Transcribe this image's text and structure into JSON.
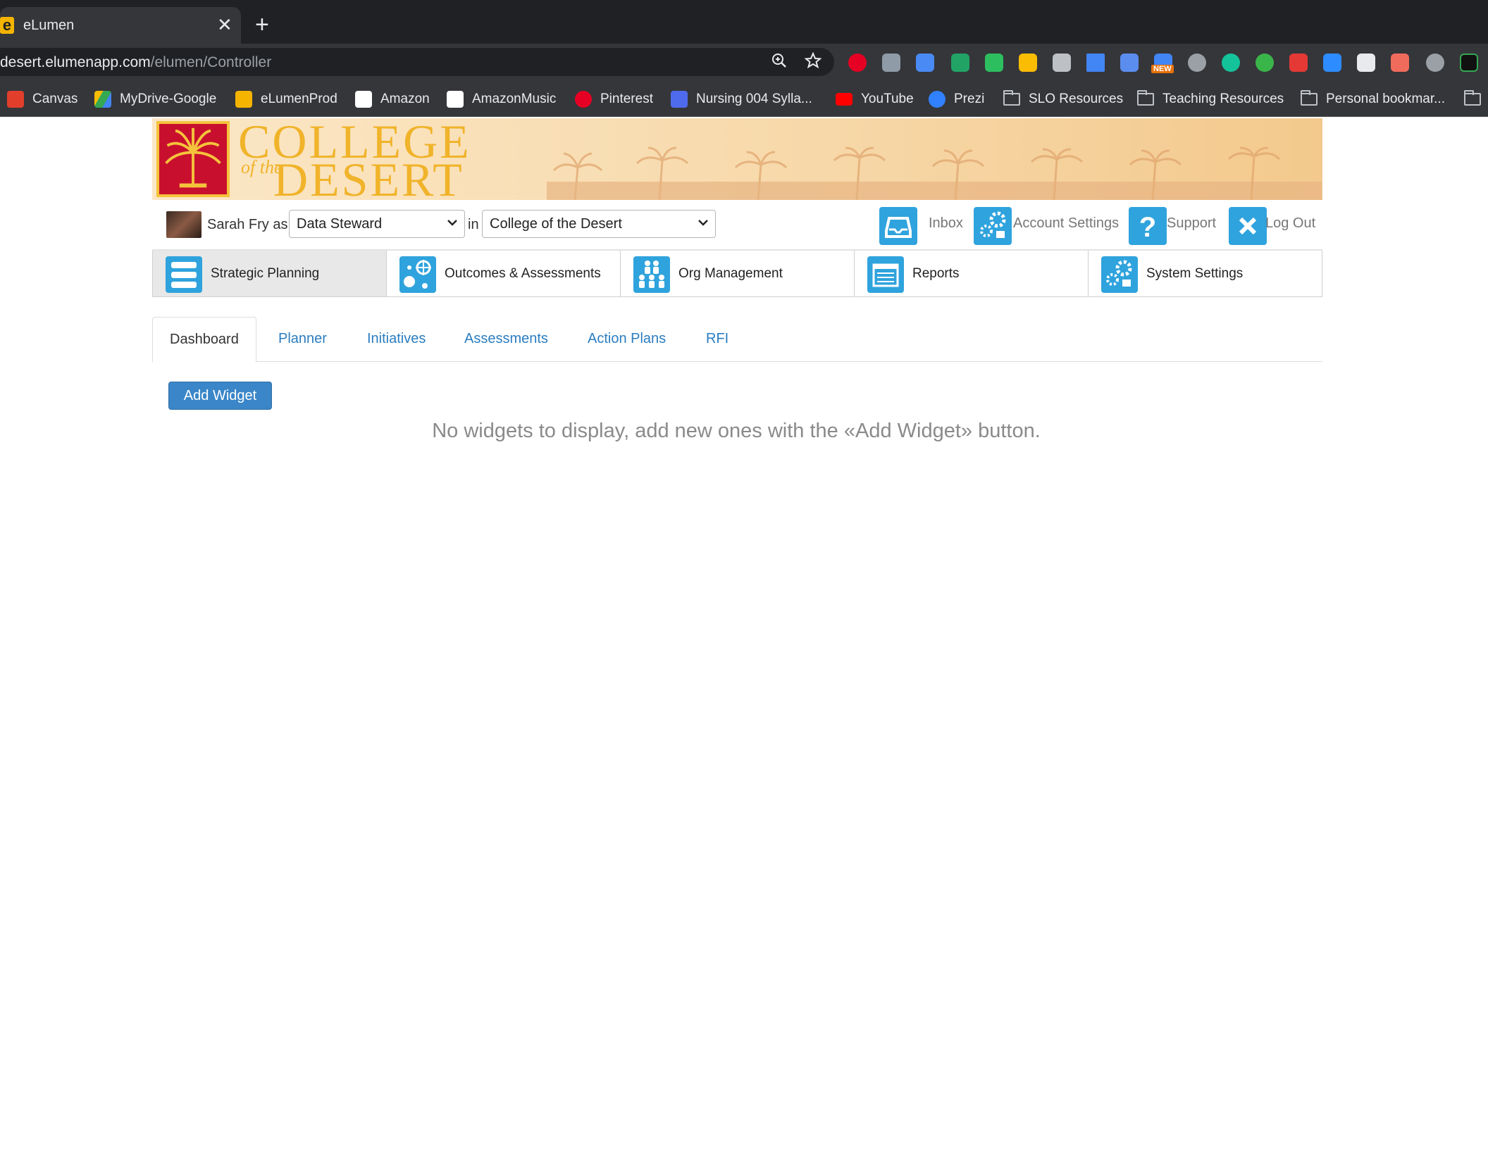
{
  "browser": {
    "tab_title": "eLumen",
    "tab_favicon": "e",
    "tab_close": "✕",
    "new_tab": "+",
    "url_host": "desert.elumenapp.com",
    "url_path": "/elumen/Controller",
    "extensions_badge": "NEW",
    "bookmarks": [
      {
        "label": "Canvas",
        "icon": "canvas-icon",
        "color": "#e13f2b"
      },
      {
        "label": "MyDrive-Google",
        "icon": "google-drive-icon",
        "color": "#34a853"
      },
      {
        "label": "eLumenProd",
        "icon": "elumen-icon",
        "color": "#f5b400"
      },
      {
        "label": "Amazon",
        "icon": "amazon-icon",
        "color": "#ffffff"
      },
      {
        "label": "AmazonMusic",
        "icon": "amazon-icon",
        "color": "#ffffff"
      },
      {
        "label": "Pinterest",
        "icon": "pinterest-icon",
        "color": "#e60023"
      },
      {
        "label": "Nursing 004 Sylla...",
        "icon": "calendar-icon",
        "color": "#4f6bed"
      },
      {
        "label": "YouTube",
        "icon": "youtube-icon",
        "color": "#ff0000"
      },
      {
        "label": "Prezi",
        "icon": "prezi-icon",
        "color": "#3181ff"
      },
      {
        "label": "SLO Resources",
        "icon": "folder-icon",
        "color": ""
      },
      {
        "label": "Teaching Resources",
        "icon": "folder-icon",
        "color": ""
      },
      {
        "label": "Personal bookmar...",
        "icon": "folder-icon",
        "color": ""
      }
    ]
  },
  "userbar": {
    "user_name": "Sarah Fry as",
    "role": "Data Steward",
    "in_label": "in",
    "institution": "College of the Desert",
    "inbox": "Inbox",
    "account_settings": "Account Settings",
    "support": "Support",
    "logout": "Log Out"
  },
  "modules": [
    {
      "label": "Strategic Planning",
      "icon": "strategic-planning-icon",
      "active": true
    },
    {
      "label": "Outcomes & Assessments",
      "icon": "outcomes-icon",
      "active": false
    },
    {
      "label": "Org Management",
      "icon": "org-management-icon",
      "active": false
    },
    {
      "label": "Reports",
      "icon": "reports-icon",
      "active": false
    },
    {
      "label": "System Settings",
      "icon": "system-settings-icon",
      "active": false
    }
  ],
  "subtabs": [
    "Dashboard",
    "Planner",
    "Initiatives",
    "Assessments",
    "Action Plans",
    "RFI"
  ],
  "add_widget_label": "Add Widget",
  "empty_message": "No widgets to display, add new ones with the «Add Widget» button.",
  "colors": {
    "accent": "#2fa3dd",
    "button": "#3a86c8",
    "link": "#2a7dc0"
  }
}
